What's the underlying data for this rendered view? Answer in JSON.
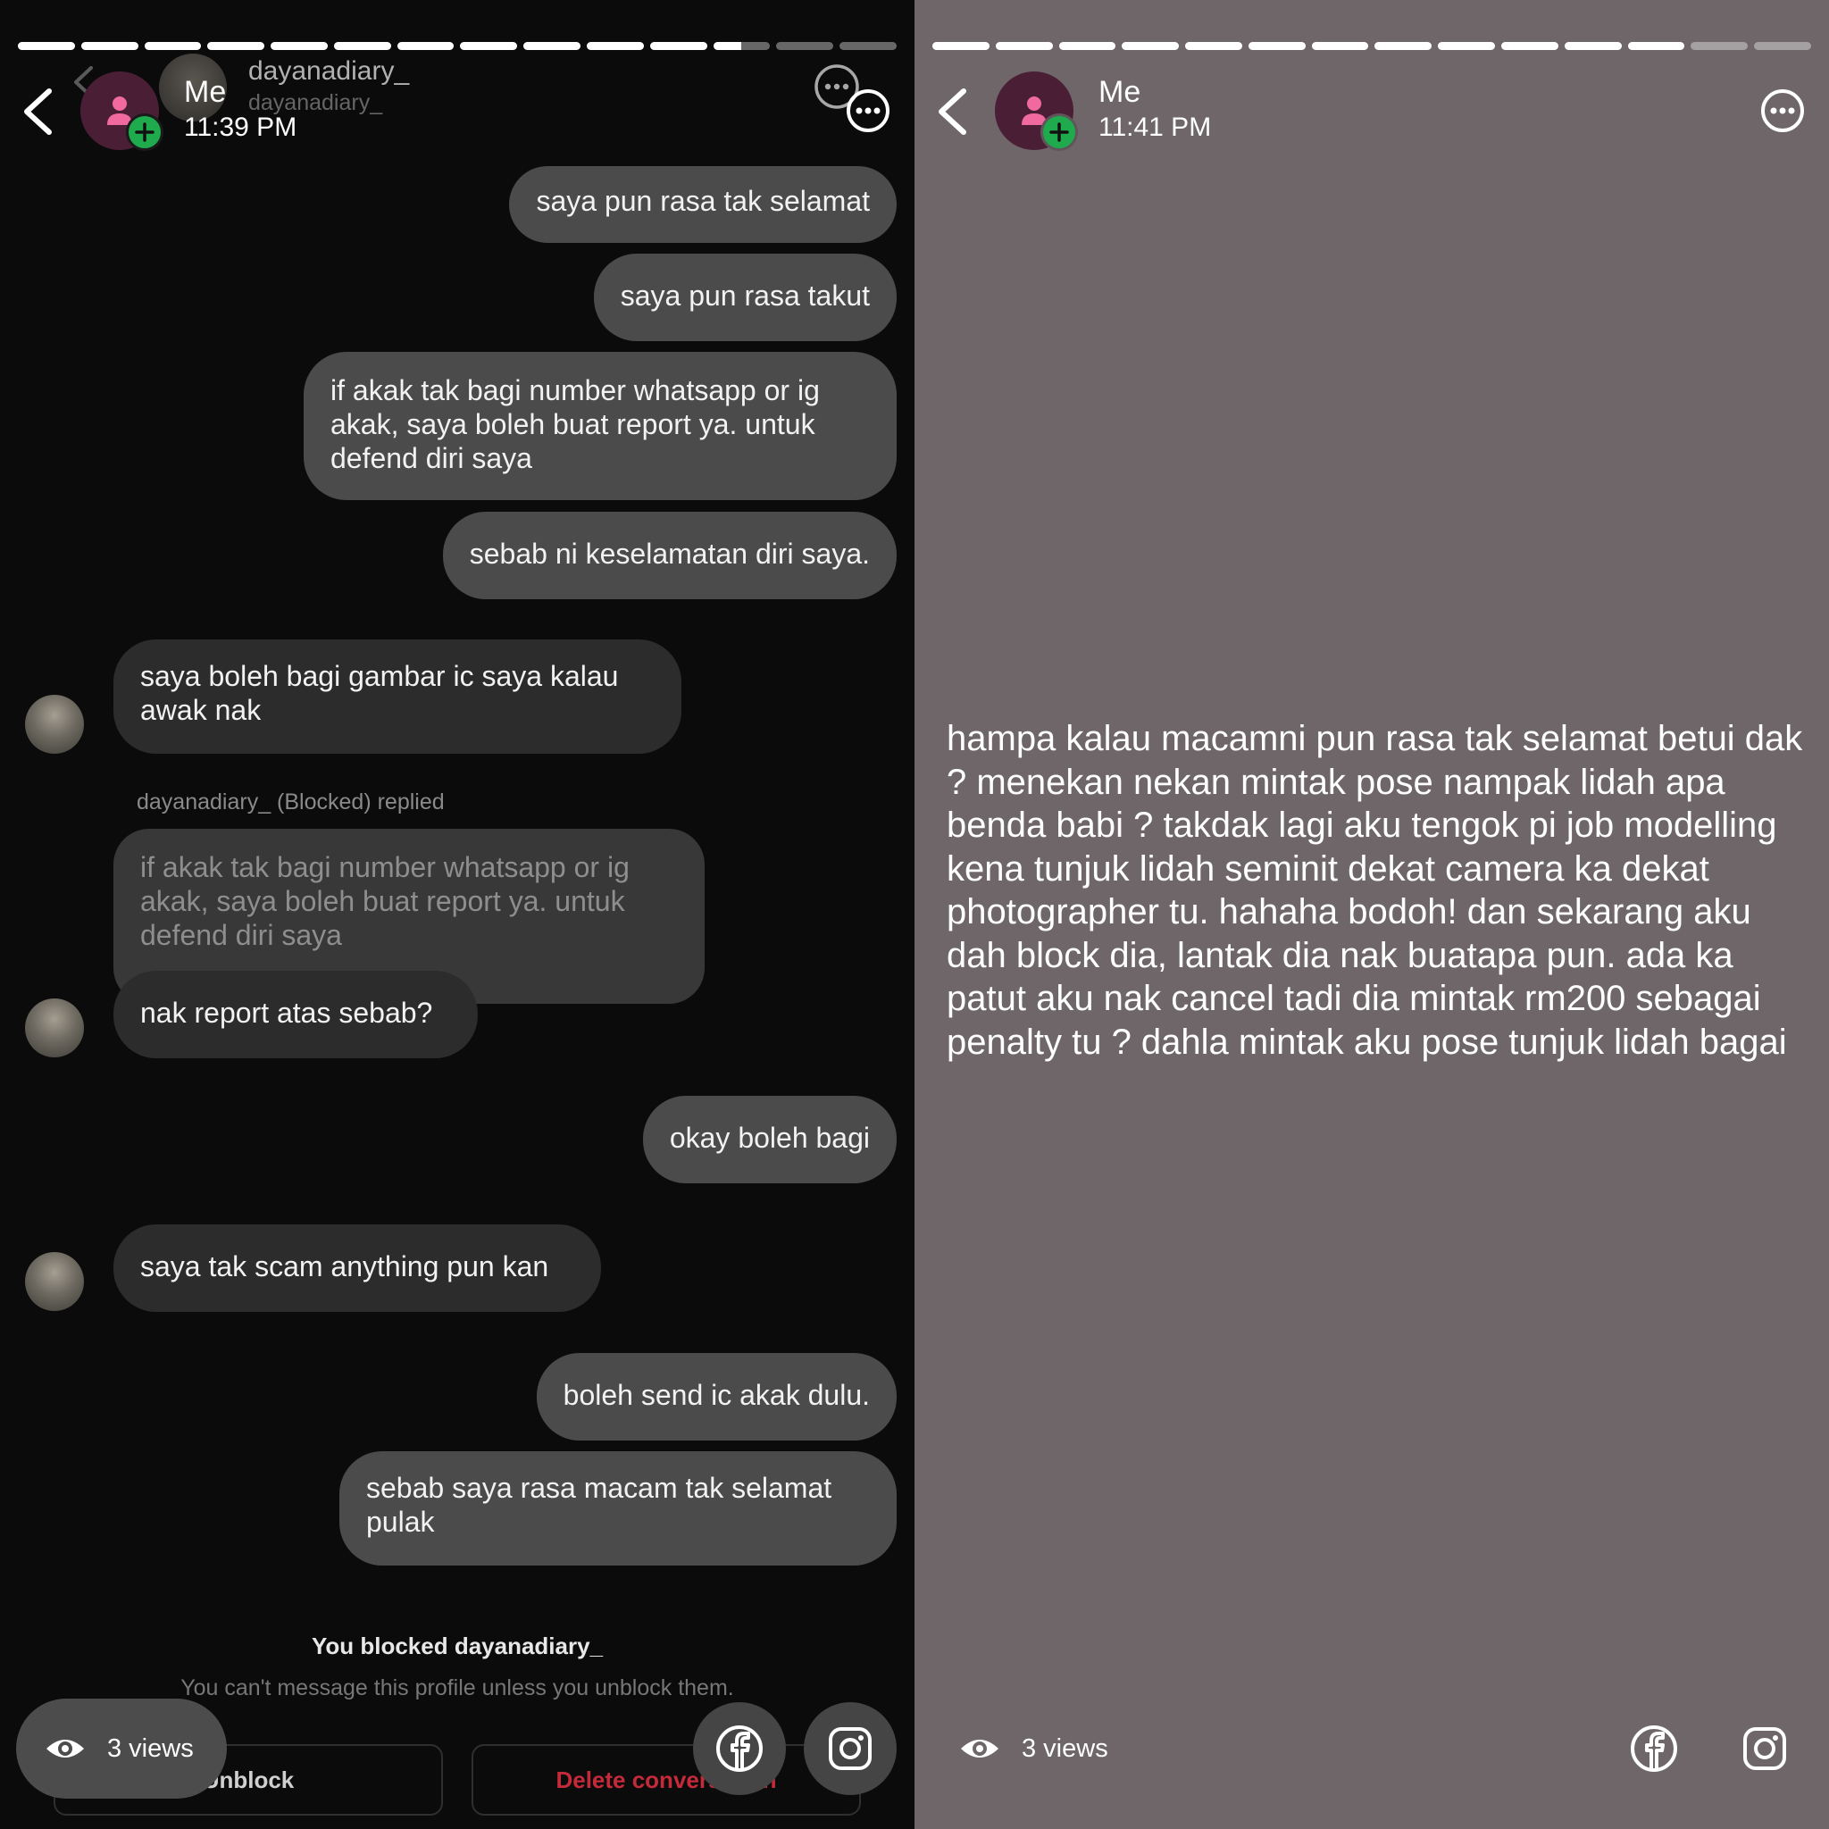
{
  "left": {
    "progress": [
      1,
      1,
      1,
      1,
      1,
      1,
      1,
      1,
      1,
      1,
      1,
      0.5,
      0,
      0
    ],
    "header": {
      "name": "Me",
      "time": "11:39 PM"
    },
    "background_header": {
      "name": "dayanadiary_",
      "handle": "dayanadiary_"
    },
    "messages": [
      {
        "side": "out",
        "text": "saya pun rasa tak selamat"
      },
      {
        "side": "out",
        "text": "saya pun rasa takut"
      },
      {
        "side": "out",
        "text": "if akak tak bagi number whatsapp or ig akak, saya boleh buat report ya. untuk defend diri saya"
      },
      {
        "side": "out",
        "text": "sebab ni keselamatan diri saya."
      },
      {
        "side": "in",
        "text": "saya boleh bagi gambar ic saya kalau awak nak"
      },
      {
        "side": "in",
        "text": "nak report atas sebab?"
      },
      {
        "side": "out",
        "text": "okay boleh bagi"
      },
      {
        "side": "in",
        "text": "saya tak scam anything pun kan"
      },
      {
        "side": "out",
        "text": "boleh send ic akak dulu."
      },
      {
        "side": "out",
        "text": "sebab saya rasa macam tak selamat pulak"
      }
    ],
    "reply": {
      "label": "dayanadiary_ (Blocked) replied",
      "quoted_text": "if akak tak bagi number whatsapp or ig akak, saya boleh buat report ya. untuk defend diri saya"
    },
    "blocked_notice": {
      "title": "You blocked dayanadiary_",
      "subtitle": "You can't message this profile unless you unblock them.",
      "unblock_label": "Unblock",
      "delete_label": "Delete conversation"
    },
    "views": "3 views"
  },
  "right": {
    "progress": [
      1,
      1,
      1,
      1,
      1,
      1,
      1,
      1,
      1,
      1,
      1,
      1,
      0,
      0
    ],
    "header": {
      "name": "Me",
      "time": "11:41 PM"
    },
    "story_text": "hampa kalau macamni pun rasa tak selamat betui dak ? menekan nekan mintak pose nampak lidah apa benda babi ? takdak lagi aku tengok pi job modelling kena tunjuk lidah seminit dekat camera ka dekat photographer tu. hahaha bodoh! dan sekarang aku dah block dia, lantak dia nak buatapa pun. ada ka patut aku nak cancel tadi dia mintak rm200 sebagai penalty tu ? dahla mintak aku pose tunjuk lidah bagai",
    "views": "3 views"
  },
  "icons": [
    "back-chevron-icon",
    "more-options-icon",
    "add-profile-icon",
    "eye-icon",
    "facebook-icon",
    "instagram-icon"
  ],
  "colors": {
    "story_bg_right": "#6e6669",
    "chat_bg_left": "#0b0b0b",
    "badge_green": "#1faa4e",
    "delete_red": "#c42a3a"
  }
}
